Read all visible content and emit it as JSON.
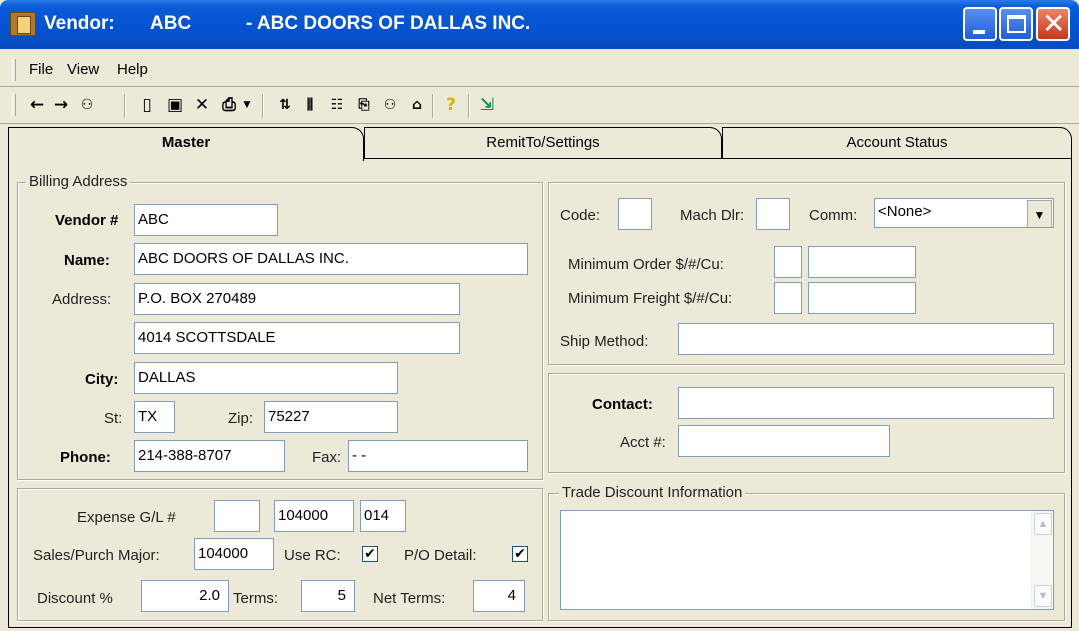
{
  "window": {
    "title_prefix": "Vendor:",
    "title_code": "ABC",
    "title_name": "- ABC DOORS OF DALLAS INC."
  },
  "menu": {
    "file": "File",
    "view": "View",
    "help": "Help"
  },
  "toolbar": {
    "icons": [
      "arrow-left-icon",
      "arrow-right-icon",
      "binoculars-icon",
      "new-document-icon",
      "save-disk-icon",
      "delete-x-icon",
      "print-icon",
      "print-dropdown-icon",
      "tool-sort-icon",
      "tool-columns-icon",
      "tool-list-icon",
      "tool-book-icon",
      "tool-binoculars2-icon",
      "tool-vendor-icon",
      "help-question-icon",
      "exit-icon"
    ]
  },
  "tabs": {
    "master": "Master",
    "remit": "RemitTo/Settings",
    "account": "Account Status"
  },
  "billing": {
    "legend": "Billing Address",
    "vendor_label": "Vendor #",
    "vendor_value": "ABC",
    "name_label": "Name:",
    "name_value": "ABC DOORS OF DALLAS INC.",
    "address_label": "Address:",
    "address1": "P.O. BOX 270489",
    "address2": "4014 SCOTTSDALE",
    "city_label": "City:",
    "city_value": "DALLAS",
    "st_label": "St:",
    "st_value": "TX",
    "zip_label": "Zip:",
    "zip_value": "75227",
    "phone_label": "Phone:",
    "phone_value": "214-388-8707",
    "fax_label": "Fax:",
    "fax_value": " -  -"
  },
  "settings": {
    "code_label": "Code:",
    "code_value": "",
    "machdlr_label": "Mach Dlr:",
    "machdlr_value": "",
    "comm_label": "Comm:",
    "comm_value": "<None>",
    "min_order_label": "Minimum Order  $/#/Cu:",
    "min_order_unit": "",
    "min_order_value": "",
    "min_freight_label": "Minimum Freight $/#/Cu:",
    "min_freight_unit": "",
    "min_freight_value": "",
    "ship_label": "Ship Method:",
    "ship_value": ""
  },
  "contact": {
    "contact_label": "Contact:",
    "contact_value": "",
    "acct_label": "Acct #:",
    "acct_value": ""
  },
  "gl": {
    "expense_label": "Expense G/L #",
    "expense_1": "",
    "expense_2": "104000",
    "expense_3": "014",
    "sales_label": "Sales/Purch Major:",
    "sales_value": "104000",
    "userc_label": "Use RC:",
    "userc_checked": true,
    "podetail_label": "P/O Detail:",
    "podetail_checked": true,
    "discount_label": "Discount %",
    "discount_value": "2.0",
    "terms_label": "Terms:",
    "terms_value": "5",
    "netterms_label": "Net Terms:",
    "netterms_value": "4"
  },
  "trade": {
    "legend": "Trade Discount Information",
    "text": ""
  },
  "glyphs": {
    "check": "✔",
    "down": "▼",
    "up": "▲",
    "scroll_down": "▼"
  }
}
